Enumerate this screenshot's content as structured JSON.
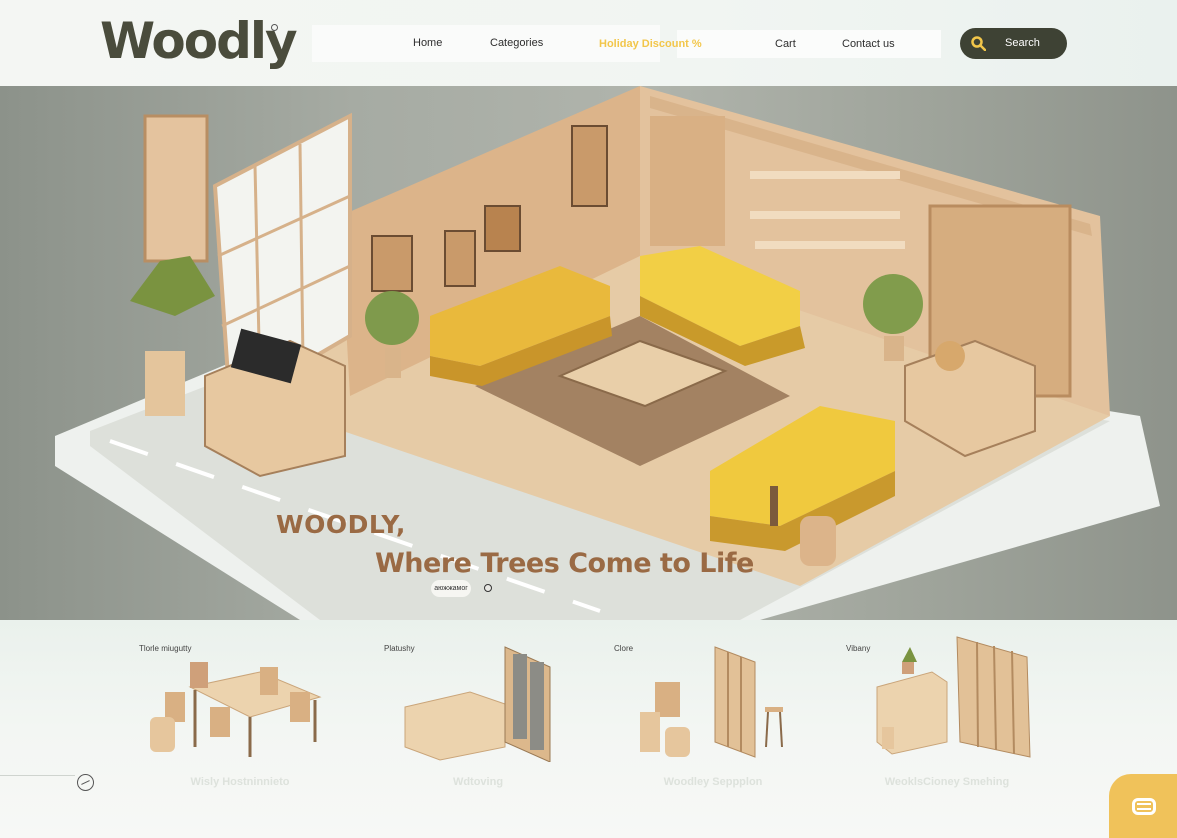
{
  "brand": {
    "logo_text": "Woodly"
  },
  "nav": {
    "home": "Home",
    "categories": "Categories",
    "holiday": "Holiday Discount %",
    "cart": "Cart",
    "contact": "Contact us",
    "search_label": "Search"
  },
  "hero": {
    "title_line1": "WOODLY,",
    "title_line2": "Where Trees Come to Life",
    "pill_text": "аюжжамог"
  },
  "products": [
    {
      "tag": "Tlorle miugutty",
      "name": "Wisly Hostninnieto"
    },
    {
      "tag": "Platushy",
      "name": "Wdtoving"
    },
    {
      "tag": "Clore",
      "name": "Woodley Seppplon"
    },
    {
      "tag": "Vibany",
      "name": "WeoklsCioney Smehing"
    }
  ],
  "colors": {
    "accent_yellow": "#f2c64a",
    "dark_olive": "#3e4234",
    "wood": "#d9b48a",
    "title_brown": "#9a6a44"
  }
}
